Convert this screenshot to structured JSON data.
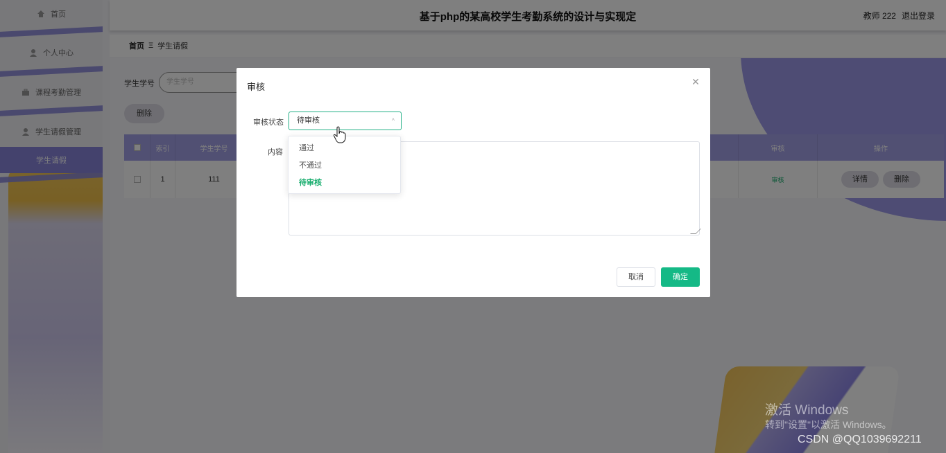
{
  "header": {
    "title": "基于php的某高校学生考勤系统的设计与实现定",
    "user": "教师 222",
    "logout": "退出登录"
  },
  "sidebar": {
    "items": [
      {
        "label": "首页",
        "icon": "home-icon"
      },
      {
        "label": "个人中心",
        "icon": "user-icon"
      },
      {
        "label": "课程考勤管理",
        "icon": "briefcase-icon"
      },
      {
        "label": "学生请假管理",
        "icon": "user-icon"
      }
    ],
    "sub_item": "学生请假"
  },
  "breadcrumb": {
    "home": "首页",
    "separator": "Ξ",
    "current": "学生请假"
  },
  "search": {
    "label": "学生学号",
    "placeholder": "学生学号"
  },
  "toolbar": {
    "delete_label": "删除"
  },
  "table": {
    "headers": [
      "索引",
      "学生学号",
      "审核",
      "操作"
    ],
    "rows": [
      {
        "index": "1",
        "student_id": "111",
        "status": "审核",
        "detail": "详情",
        "delete": "删除"
      }
    ]
  },
  "dialog": {
    "title": "审核",
    "status_label": "审核状态",
    "status_value": "待审核",
    "content_label": "内容",
    "options": [
      "通过",
      "不通过",
      "待审核"
    ],
    "selected_option": "待审核",
    "cancel": "取消",
    "confirm": "确定"
  },
  "watermark": {
    "line1": "激活 Windows",
    "line2": "转到\"设置\"以激活 Windows。",
    "csdn": "CSDN @QQ1039692211"
  },
  "colors": {
    "accent": "#15b986",
    "sidebar_active": "#8985db",
    "table_header": "#a3a0e6"
  }
}
